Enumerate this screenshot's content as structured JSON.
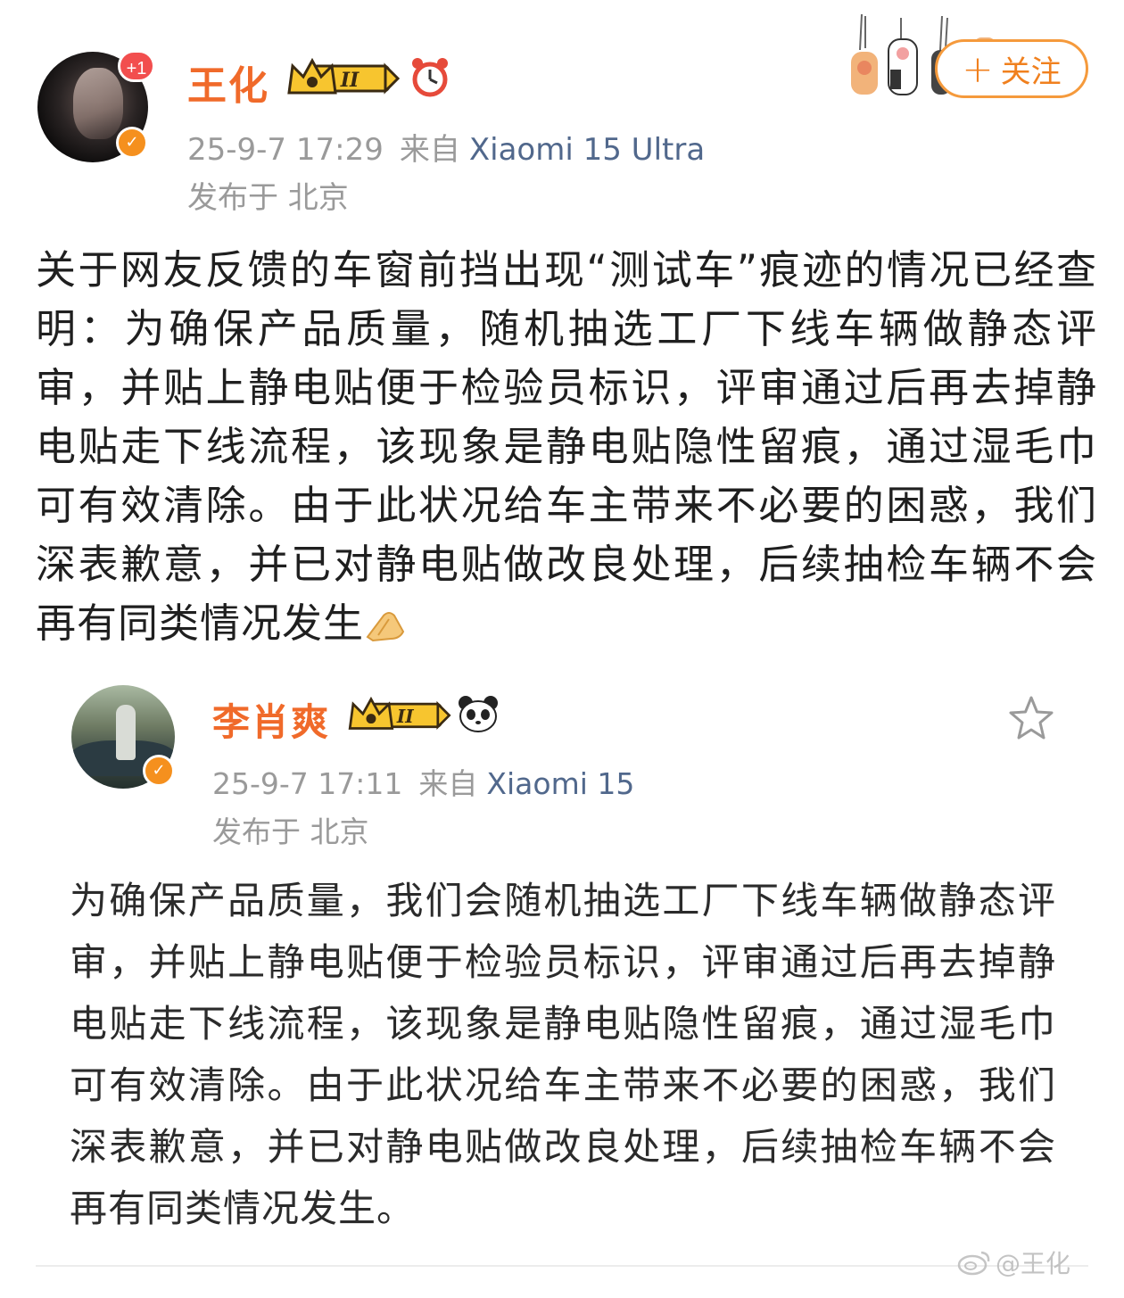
{
  "main_post": {
    "notification_badge": "+1",
    "username": "王化",
    "level_badge": "II",
    "timestamp": "25-9-7 17:29",
    "from_label": "来自",
    "device": "Xiaomi 15 Ultra",
    "location": "发布于 北京",
    "follow_label": "关注",
    "text": "关于网友反馈的车窗前挡出现“测试车”痕迹的情况已经查明：为确保产品质量，随机抽选工厂下线车辆做静态评审，并贴上静电贴便于检验员标识，评审通过后再去掉静电贴走下线流程，该现象是静电贴隐性留痕，通过湿毛巾可有效清除。由于此状况给车主带来不必要的困惑，我们深表歉意，并已对静电贴做改良处理，后续抽检车辆不会再有同类情况发生",
    "trailing_emoji": "praying-hands-icon"
  },
  "quoted_post": {
    "username": "李肖爽",
    "level_badge": "II",
    "timestamp": "25-9-7 17:11",
    "from_label": "来自",
    "device": "Xiaomi 15",
    "location": "发布于 北京",
    "text": "为确保产品质量，我们会随机抽选工厂下线车辆做静态评审，并贴上静电贴便于检验员标识，评审通过后再去掉静电贴走下线流程，该现象是静电贴隐性留痕，通过湿毛巾可有效清除。由于此状况给车主带来不必要的困惑，我们深表歉意，并已对静电贴做改良处理，后续抽检车辆不会再有同类情况发生。"
  },
  "watermark": "@王化",
  "colors": {
    "username": "#f06a2a",
    "follow_border": "#f59a3c",
    "device_link": "#51688c",
    "meta_gray": "#9a9a9a",
    "verified": "#f5901e"
  }
}
